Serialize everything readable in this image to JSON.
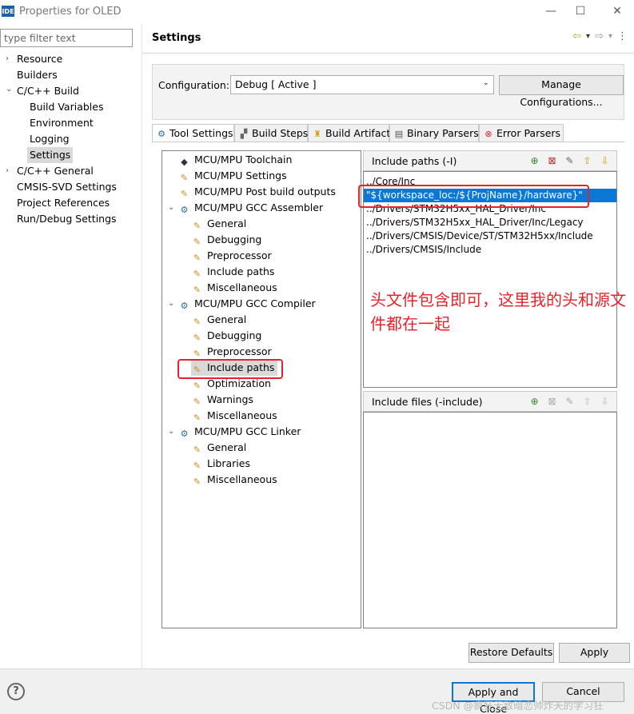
{
  "window": {
    "app_icon_text": "IDE",
    "title": "Properties for OLED",
    "minimize": "—",
    "maximize": "☐",
    "close": "✕"
  },
  "left_pane": {
    "filter_placeholder": "type filter text",
    "items": [
      {
        "label": "Resource",
        "arrow": "›"
      },
      {
        "label": "Builders",
        "arrow": ""
      },
      {
        "label": "C/C++ Build",
        "arrow": "⌄"
      },
      {
        "label": "Build Variables",
        "arrow": ""
      },
      {
        "label": "Environment",
        "arrow": ""
      },
      {
        "label": "Logging",
        "arrow": ""
      },
      {
        "label": "Settings",
        "arrow": ""
      },
      {
        "label": "C/C++ General",
        "arrow": "›"
      },
      {
        "label": "CMSIS-SVD Settings",
        "arrow": ""
      },
      {
        "label": "Project References",
        "arrow": ""
      },
      {
        "label": "Run/Debug Settings",
        "arrow": ""
      }
    ]
  },
  "header": {
    "title": "Settings",
    "back_icon": "⇦",
    "forward_icon": "⇨",
    "menu_icon": "⋮",
    "dropdown_icon": "▾"
  },
  "configuration": {
    "label": "Configuration:",
    "value": "Debug  [ Active ]",
    "manage_button": "Manage Configurations..."
  },
  "tabs": [
    {
      "label": "Tool Settings",
      "icon": "gear-icon"
    },
    {
      "label": "Build Steps",
      "icon": "steps-icon"
    },
    {
      "label": "Build Artifact",
      "icon": "trophy-icon"
    },
    {
      "label": "Binary Parsers",
      "icon": "file-icon"
    },
    {
      "label": "Error Parsers",
      "icon": "error-icon"
    }
  ],
  "tool_tree": [
    {
      "label": "MCU/MPU Toolchain",
      "icon": "chip",
      "arrow": ""
    },
    {
      "label": "MCU/MPU Settings",
      "icon": "tool",
      "arrow": ""
    },
    {
      "label": "MCU/MPU Post build outputs",
      "icon": "tool",
      "arrow": ""
    },
    {
      "label": "MCU/MPU GCC Assembler",
      "icon": "gear",
      "arrow": "⌄"
    },
    {
      "label": "General",
      "icon": "tool",
      "arrow": ""
    },
    {
      "label": "Debugging",
      "icon": "tool",
      "arrow": ""
    },
    {
      "label": "Preprocessor",
      "icon": "tool",
      "arrow": ""
    },
    {
      "label": "Include paths",
      "icon": "tool",
      "arrow": ""
    },
    {
      "label": "Miscellaneous",
      "icon": "tool",
      "arrow": ""
    },
    {
      "label": "MCU/MPU GCC Compiler",
      "icon": "gear",
      "arrow": "⌄"
    },
    {
      "label": "General",
      "icon": "tool",
      "arrow": ""
    },
    {
      "label": "Debugging",
      "icon": "tool",
      "arrow": ""
    },
    {
      "label": "Preprocessor",
      "icon": "tool",
      "arrow": ""
    },
    {
      "label": "Include paths",
      "icon": "tool",
      "arrow": ""
    },
    {
      "label": "Optimization",
      "icon": "tool",
      "arrow": ""
    },
    {
      "label": "Warnings",
      "icon": "tool",
      "arrow": ""
    },
    {
      "label": "Miscellaneous",
      "icon": "tool",
      "arrow": ""
    },
    {
      "label": "MCU/MPU GCC Linker",
      "icon": "gear",
      "arrow": "⌄"
    },
    {
      "label": "General",
      "icon": "tool",
      "arrow": ""
    },
    {
      "label": "Libraries",
      "icon": "tool",
      "arrow": ""
    },
    {
      "label": "Miscellaneous",
      "icon": "tool",
      "arrow": ""
    }
  ],
  "include_paths": {
    "title": "Include paths (-I)",
    "rows": [
      "../Core/Inc",
      "\"${workspace_loc:/${ProjName}/hardware}\"",
      "../Drivers/STM32H5xx_HAL_Driver/Inc",
      "../Drivers/STM32H5xx_HAL_Driver/Inc/Legacy",
      "../Drivers/CMSIS/Device/ST/STM32H5xx/Include",
      "../Drivers/CMSIS/Include"
    ]
  },
  "include_files": {
    "title": "Include files (-include)"
  },
  "annotation": "头文件包含即可，这里我的头和源文件都在一起",
  "buttons": {
    "restore": "Restore Defaults",
    "apply": "Apply",
    "apply_close": "Apply and Close",
    "cancel": "Cancel",
    "help": "?"
  },
  "watermark": "CSDN @疯狂无敌暗恋帅炸天的学习狂",
  "colors": {
    "selection": "#0a78d7",
    "annotation": "#e8222a",
    "tree_selection": "#d9d9d9"
  }
}
